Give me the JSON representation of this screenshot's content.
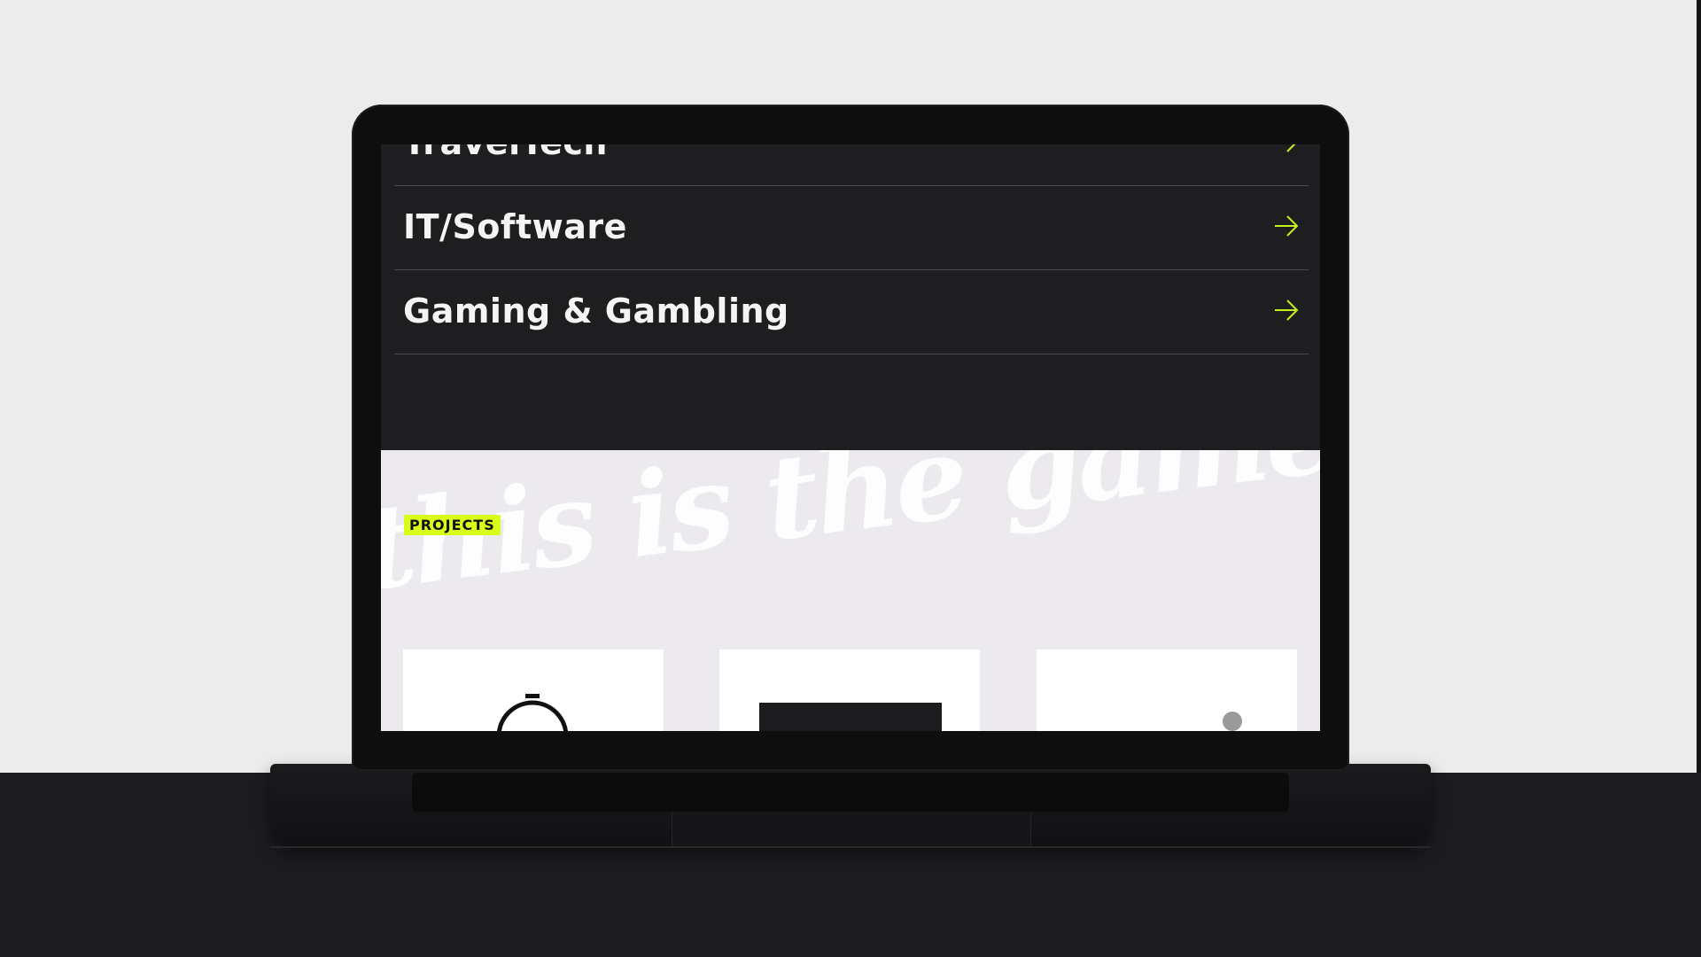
{
  "industries": [
    {
      "label": "TravelTech",
      "icon": "arrow-right-icon"
    },
    {
      "label": "IT/Software",
      "icon": "arrow-right-icon"
    },
    {
      "label": "Gaming & Gambling",
      "icon": "arrow-right-icon"
    }
  ],
  "projects": {
    "tag_label": "PROJECTS",
    "background_script": "this is the game we play"
  },
  "colors": {
    "accent": "#d8ff1a",
    "arrow": "#c6f01a",
    "dark_bg": "#1e1e20",
    "light_bg": "#eceaef",
    "text_light": "#f4f4f4"
  }
}
